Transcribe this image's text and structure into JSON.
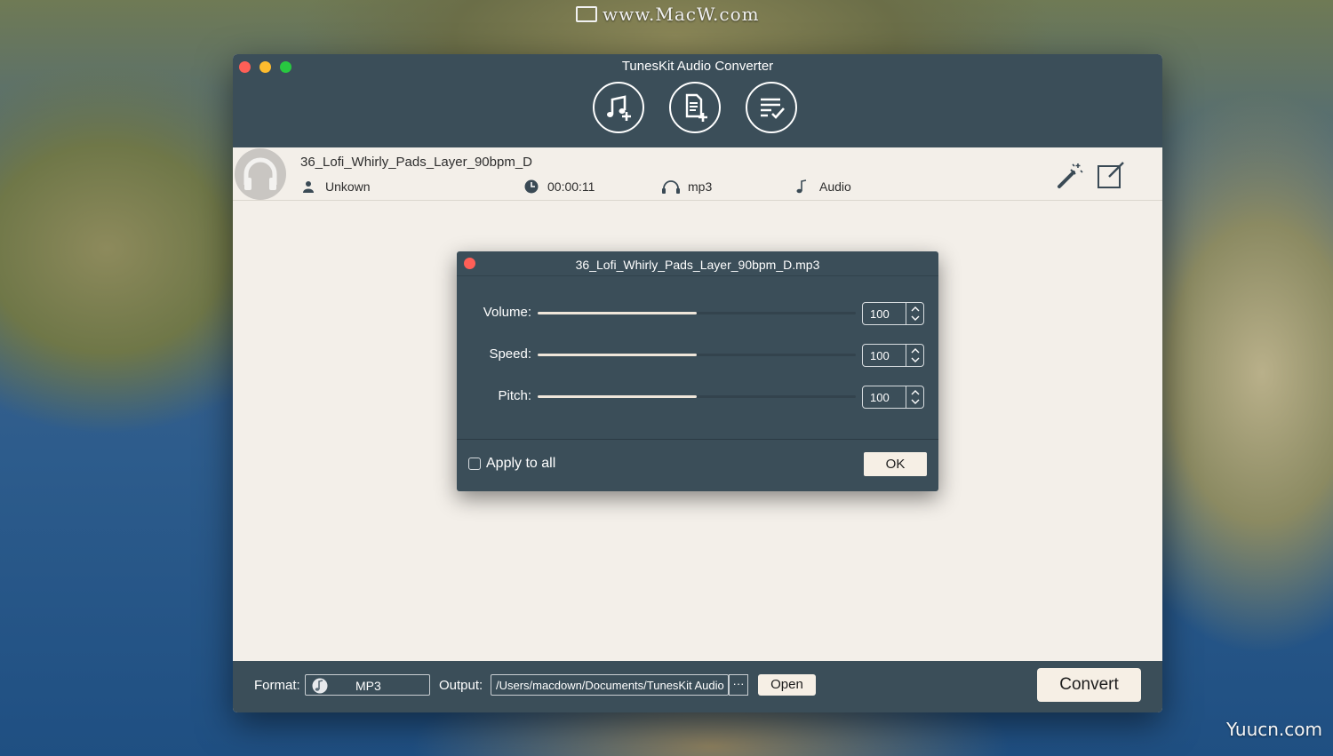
{
  "watermarks": {
    "top": "www.MacW.com",
    "bottom": "Yuucn.com"
  },
  "window": {
    "title": "TunesKit Audio Converter"
  },
  "toolbar": {
    "icons": [
      "add-music-icon",
      "add-file-icon",
      "converted-list-icon"
    ]
  },
  "file": {
    "name": "36_Lofi_Whirly_Pads_Layer_90bpm_D",
    "artist": "Unkown",
    "duration": "00:00:11",
    "format": "mp3",
    "type": "Audio"
  },
  "dialog": {
    "title": "36_Lofi_Whirly_Pads_Layer_90bpm_D.mp3",
    "sliders": [
      {
        "label": "Volume:",
        "value": "100",
        "level": 0.5
      },
      {
        "label": "Speed:",
        "value": "100",
        "level": 0.5
      },
      {
        "label": "Pitch:",
        "value": "100",
        "level": 0.5
      }
    ],
    "apply_all_label": "Apply to all",
    "ok_label": "OK"
  },
  "bottom": {
    "format_label": "Format:",
    "format_value": "MP3",
    "output_label": "Output:",
    "output_path": "/Users/macdown/Documents/TunesKit Audio Converter",
    "browse_label": "···",
    "open_label": "Open",
    "convert_label": "Convert"
  },
  "colors": {
    "chrome": "#3b4e59",
    "content": "#f3efe9",
    "button": "#f6efe5",
    "slider_fill": "#efe6da"
  }
}
